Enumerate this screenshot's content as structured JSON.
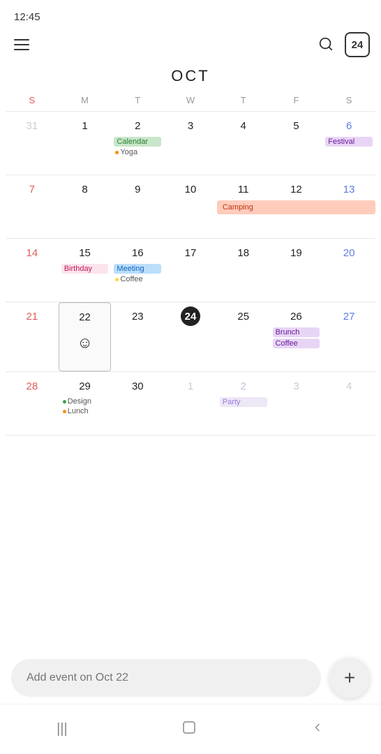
{
  "status": {
    "time": "12:45"
  },
  "header": {
    "month_label": "OCT",
    "badge_number": "24"
  },
  "day_headers": [
    "S",
    "M",
    "T",
    "W",
    "T",
    "F",
    "S"
  ],
  "weeks": [
    {
      "days": [
        {
          "num": "31",
          "type": "other-month sunday"
        },
        {
          "num": "1",
          "type": ""
        },
        {
          "num": "2",
          "type": "",
          "events": [
            {
              "label": "Calendar",
              "style": "green-bg"
            }
          ],
          "dots": [
            {
              "color": "orange",
              "label": "Yoga"
            }
          ]
        },
        {
          "num": "3",
          "type": ""
        },
        {
          "num": "4",
          "type": ""
        },
        {
          "num": "5",
          "type": ""
        },
        {
          "num": "6",
          "type": "saturday",
          "festival": "Festival"
        }
      ]
    },
    {
      "days": [
        {
          "num": "7",
          "type": "sunday"
        },
        {
          "num": "8",
          "type": ""
        },
        {
          "num": "9",
          "type": ""
        },
        {
          "num": "10",
          "type": ""
        },
        {
          "num": "11",
          "type": "",
          "camping_start": true
        },
        {
          "num": "12",
          "type": ""
        },
        {
          "num": "13",
          "type": "saturday"
        }
      ],
      "camping": "Camping"
    },
    {
      "days": [
        {
          "num": "14",
          "type": "sunday"
        },
        {
          "num": "15",
          "type": "",
          "events": [
            {
              "label": "Birthday",
              "style": "pink-bg"
            }
          ]
        },
        {
          "num": "16",
          "type": "",
          "events": [
            {
              "label": "Meeting",
              "style": "blue-bg"
            }
          ],
          "dots": [
            {
              "color": "yellow",
              "label": "Coffee"
            }
          ]
        },
        {
          "num": "17",
          "type": ""
        },
        {
          "num": "18",
          "type": ""
        },
        {
          "num": "19",
          "type": ""
        },
        {
          "num": "20",
          "type": "saturday"
        }
      ]
    },
    {
      "days": [
        {
          "num": "21",
          "type": "sunday"
        },
        {
          "num": "22",
          "type": "selected",
          "smiley": true
        },
        {
          "num": "23",
          "type": ""
        },
        {
          "num": "24",
          "type": "today"
        },
        {
          "num": "25",
          "type": ""
        },
        {
          "num": "26",
          "type": "",
          "events": [
            {
              "label": "Brunch",
              "style": "purple-bg"
            },
            {
              "label": "Coffee",
              "style": "purple-bg"
            }
          ]
        },
        {
          "num": "27",
          "type": "saturday"
        }
      ]
    },
    {
      "days": [
        {
          "num": "28",
          "type": "sunday"
        },
        {
          "num": "29",
          "type": "",
          "dots": [
            {
              "color": "green",
              "label": "Design"
            },
            {
              "color": "orange",
              "label": "Lunch"
            }
          ]
        },
        {
          "num": "30",
          "type": ""
        },
        {
          "num": "1",
          "type": "other-month"
        },
        {
          "num": "2",
          "type": "other-month-purple",
          "events": [
            {
              "label": "Party",
              "style": "purple-light"
            }
          ]
        },
        {
          "num": "3",
          "type": "other-month"
        },
        {
          "num": "4",
          "type": "other-month saturday"
        }
      ]
    }
  ],
  "bottom": {
    "placeholder": "Add event on Oct 22",
    "fab_label": "+"
  },
  "nav": {
    "menu_icon": "|||",
    "home_icon": "○",
    "back_icon": "<"
  }
}
